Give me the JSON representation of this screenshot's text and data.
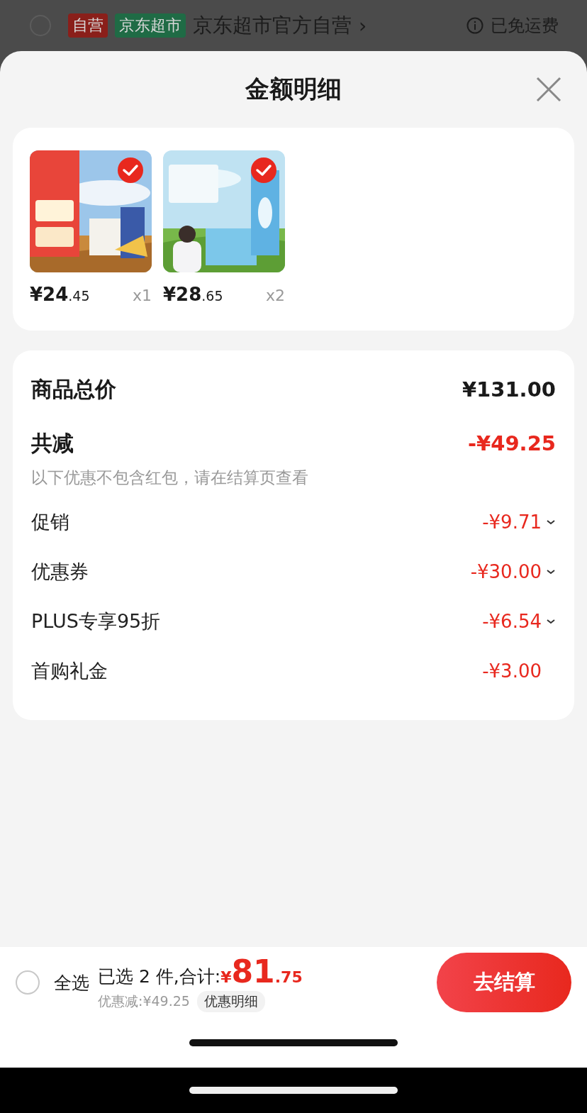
{
  "background_store_row": {
    "checked": false,
    "tags": [
      {
        "label": "自营",
        "color": "#8a1f1a"
      },
      {
        "label": "京东超市",
        "color": "#1f6b45"
      }
    ],
    "store_name": "京东超市官方自营",
    "chevron": "›",
    "shipping": "已免运费"
  },
  "sheet": {
    "title": "金额明细",
    "products": [
      {
        "kind": "picture",
        "selected": true,
        "price": "¥24.45",
        "quantity": "x1"
      },
      {
        "kind": "picture",
        "selected": true,
        "price": "¥28.65",
        "quantity": "x2"
      }
    ],
    "summary": {
      "total_label": "商品总价",
      "total_value": "¥131.00",
      "reduction_label": "共减",
      "reduction_value": "-¥49.25",
      "note": "以下优惠不包含红包，请在结算页查看",
      "items": [
        {
          "label": "促销",
          "value": "-¥9.71",
          "expandable": true
        },
        {
          "label": "优惠券",
          "value": "-¥30.00",
          "expandable": true
        },
        {
          "label": "PLUS专享95折",
          "value": "-¥6.54",
          "expandable": true
        },
        {
          "label": "首购礼金",
          "value": "-¥3.00",
          "expandable": false
        }
      ]
    }
  },
  "bottom_bar": {
    "select_all": {
      "label": "全选",
      "checked": false
    },
    "total_label": "已选 2 件,合计:",
    "total": "¥81.75",
    "discount": "优惠减:¥49.25",
    "details_link": "优惠明细",
    "checkout": "去结算"
  }
}
